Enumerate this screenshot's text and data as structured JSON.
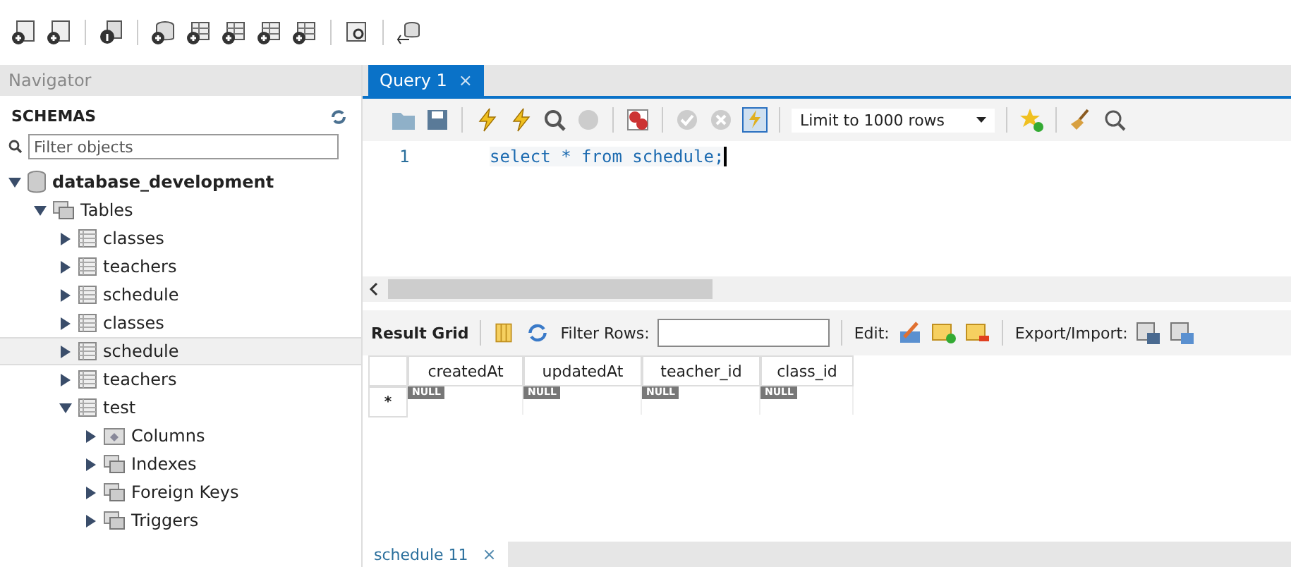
{
  "navigator": {
    "title": "Navigator",
    "section": "SCHEMAS",
    "filter": {
      "placeholder": "Filter objects"
    },
    "tree": [
      {
        "label": "database_development",
        "kind": "schema",
        "expanded": true,
        "selected": false,
        "children": [
          {
            "label": "Tables",
            "kind": "folder",
            "expanded": true,
            "selected": false,
            "children": [
              {
                "label": "classes",
                "kind": "table",
                "expanded": false,
                "selected": false
              },
              {
                "label": "teachers",
                "kind": "table",
                "expanded": false,
                "selected": false
              },
              {
                "label": "schedule",
                "kind": "table",
                "expanded": false,
                "selected": false
              },
              {
                "label": "classes",
                "kind": "table",
                "expanded": false,
                "selected": false
              },
              {
                "label": "schedule",
                "kind": "table",
                "expanded": false,
                "selected": true
              },
              {
                "label": "teachers",
                "kind": "table",
                "expanded": false,
                "selected": false
              },
              {
                "label": "test",
                "kind": "table",
                "expanded": true,
                "selected": false,
                "children": [
                  {
                    "label": "Columns",
                    "kind": "columns",
                    "expanded": false,
                    "selected": false
                  },
                  {
                    "label": "Indexes",
                    "kind": "folder",
                    "expanded": false,
                    "selected": false
                  },
                  {
                    "label": "Foreign Keys",
                    "kind": "folder",
                    "expanded": false,
                    "selected": false
                  },
                  {
                    "label": "Triggers",
                    "kind": "folder",
                    "expanded": false,
                    "selected": false
                  }
                ]
              }
            ]
          }
        ]
      }
    ]
  },
  "query_tab": {
    "label": "Query 1",
    "close": "×",
    "selected": true
  },
  "limit": "Limit to 1000 rows",
  "editor": {
    "line_number": "1",
    "code": "select * from schedule;"
  },
  "result_toolbar": {
    "result_grid": "Result Grid",
    "filter_label": "Filter Rows:",
    "edit_label": "Edit:",
    "export_label": "Export/Import:"
  },
  "grid": {
    "columns": [
      "createdAt",
      "updatedAt",
      "teacher_id",
      "class_id"
    ],
    "row_marker": "*",
    "cells": [
      "NULL",
      "NULL",
      "NULL",
      "NULL"
    ]
  },
  "bottom_tab": {
    "label": "schedule 11",
    "close": "×"
  }
}
